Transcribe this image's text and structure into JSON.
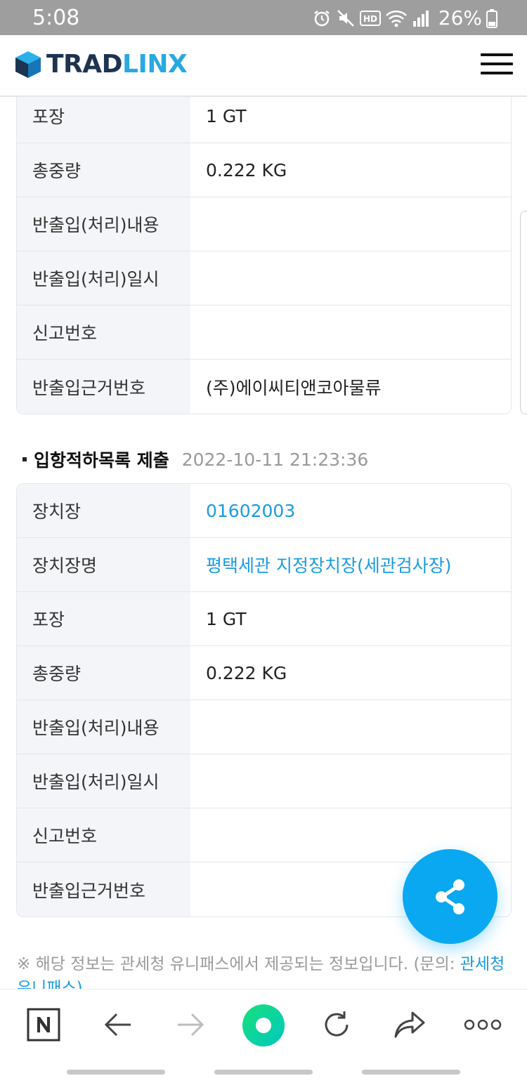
{
  "status_bar": {
    "time": "5:08",
    "battery": "26%"
  },
  "header": {
    "logo_part1": "TRAD",
    "logo_part2": "LINX",
    "menu_icon": "hamburger-menu-icon"
  },
  "top_table": {
    "rows": [
      {
        "label": "포장",
        "value": "1 GT"
      },
      {
        "label": "총중량",
        "value": "0.222 KG"
      },
      {
        "label": "반출입(처리)내용",
        "value": ""
      },
      {
        "label": "반출입(처리)일시",
        "value": ""
      },
      {
        "label": "신고번호",
        "value": ""
      },
      {
        "label": "반출입근거번호",
        "value": "(주)에이씨티앤코아물류"
      }
    ]
  },
  "section": {
    "title": "입항적하목록 제출",
    "datetime": "2022-10-11 21:23:36"
  },
  "bottom_table": {
    "rows": [
      {
        "label": "장치장",
        "value": "01602003"
      },
      {
        "label": "장치장명",
        "value": "평택세관 지정장치장(세관검사장)"
      },
      {
        "label": "포장",
        "value": "1 GT"
      },
      {
        "label": "총중량",
        "value": "0.222 KG"
      },
      {
        "label": "반출입(처리)내용",
        "value": ""
      },
      {
        "label": "반출입(처리)일시",
        "value": ""
      },
      {
        "label": "신고번호",
        "value": ""
      },
      {
        "label": "반출입근거번호",
        "value": ""
      }
    ]
  },
  "notice": {
    "text": "※ 해당 정보는 관세청 유니패스에서 제공되는 정보입니다. (문의: ",
    "link": "관세청 유니패스)"
  },
  "colors": {
    "accent": "#0aa8f0",
    "link": "#1b9be0",
    "logo_dark": "#1e3350",
    "logo_light": "#29a9e1",
    "status_bar": "#9e9e9e"
  }
}
